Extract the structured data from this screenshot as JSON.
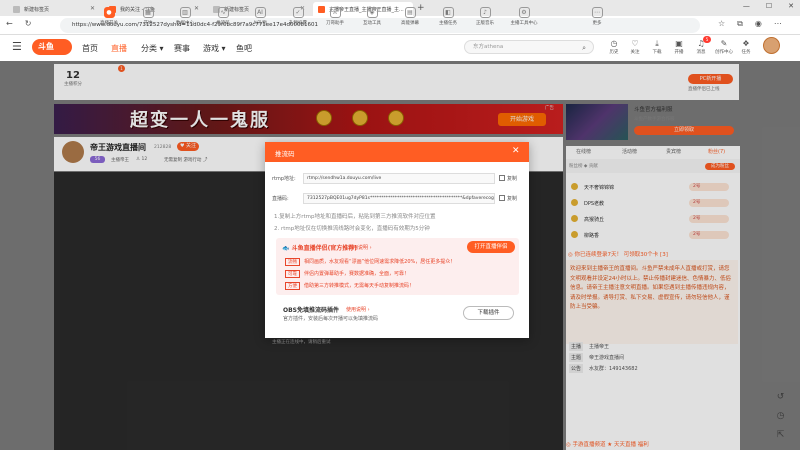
{
  "browser": {
    "tabs": [
      {
        "title": "新建标签页"
      },
      {
        "title": "我的关注 - 斗鱼"
      },
      {
        "title": "新建标签页"
      },
      {
        "title": "主播帝王直播_主播帝王直播_主..."
      }
    ],
    "url": "https://www.douyu.com/7312527dyshid=11d0dc4-f29f0bc89f7a9c771ee17e4d00081601"
  },
  "header": {
    "logo": "斗鱼",
    "nav": [
      "首页",
      "直播",
      "分类",
      "赛事",
      "游戏",
      "鱼吧"
    ],
    "search_placeholder": "东方athena",
    "top_icons": [
      "历史",
      "关注",
      "下载",
      "开播",
      "消息",
      "创作中心",
      "任务"
    ],
    "message_badge": "5"
  },
  "toolbar": {
    "level_number": "12",
    "level_label": "主播积分",
    "open_badge": "1",
    "tools": [
      "直播开关",
      "开始",
      "数据中心",
      "推流码",
      "AI礼物",
      "礼物投票",
      "刀哥助手",
      "互动工具",
      "高能弹幕",
      "主播任务",
      "正版音乐",
      "主播工具中心",
      "更多"
    ],
    "pc_button": "PC新开播",
    "pc_link": "直播伴侣已上线"
  },
  "banner": {
    "title": "超变一人一鬼服",
    "button": "开始游戏",
    "ad": "广告"
  },
  "game_ad": {
    "title": "斗鱼官方福利服",
    "subtitle": "斗鱼产数手游合作服",
    "button": "立即领取"
  },
  "streamer": {
    "name": "帝王游戏直播间",
    "room_id": "212828",
    "follow": "关注",
    "level": "56",
    "role": "主播帝王",
    "sub_count": "12",
    "category": "无需复制",
    "sub_category": "游戏行动"
  },
  "video": {
    "status_text": "主播正在连线中，请稍后重试"
  },
  "right_panel": {
    "tabs": [
      "在线榜",
      "活动榜",
      "贵宾榜",
      "粉丝(7)"
    ],
    "rank_label": "粉丝榜 ◆ 贡献",
    "rank_button": "成为粉丝",
    "rows": [
      {
        "name": "天不奢锦锦锦",
        "badge": "2号"
      },
      {
        "name": "DPS老教",
        "badge": "2号"
      },
      {
        "name": "高猴骑丘",
        "badge": "2号"
      },
      {
        "name": "柳路香",
        "badge": "2号"
      }
    ],
    "login_note": "◎ 你已连续登录7天！ 可领取30个卡 [3]",
    "notice": "欢迎来到主播帝王的直播间。斗鱼严禁未成年人直播或打赏，请您文明观看并设定24小时以上。禁止传播封建迷信、色情暴力、低俗信息。请帝王主播注意文明直播。如果您遇到主播传播违规内容，请及时举报。诱导打赏、私下交易、虚假宣传，请勿轻信他人，谨防上当受骗。",
    "info": [
      {
        "label": "主播",
        "value": "主播帝王"
      },
      {
        "label": "主题",
        "value": "帝王游戏直播间"
      },
      {
        "label": "公告",
        "value": "水友群：149143682"
      }
    ],
    "bottom_text": "◎ 手游直播频道 ★ 天天直播 福利"
  },
  "modal": {
    "title": "推流码",
    "rtmp_label": "rtmp地址:",
    "rtmp_value": "rtmp://sendhw1a.douyu.com/live",
    "code_label": "直播码:",
    "code_value": "7312527pBQE01ug7dyP81s*****************************************&dpfaverecognition=",
    "copy": "复制",
    "tip1": "1.复制上方rtmp地址和直播码后，粘贴到第三方推流软件对应位置",
    "tip2": "2. rtmp地址仅在切换推流线路时会变化，直播码有效期为5分钟",
    "promo_title": "斗鱼直播伴侣(官方推荐)",
    "promo_guide": "使用说明 ›",
    "promo_button": "打开直播伴侣",
    "promo_rows": [
      {
        "tag": "流畅",
        "text": "相同画质，水友观看“漂画”他位网速需求降低20%，居任更多提众！"
      },
      {
        "tag": "可靠",
        "text": "伴侣内置弹幕助手，赛数据准确，全面，可靠！"
      },
      {
        "tag": "方便",
        "text": "借助第三方转推模式，无需每天手动复制推流码！"
      }
    ],
    "obs_title": "OBS免填推流码插件",
    "obs_guide": "使用说明 ›",
    "obs_desc": "官方插件，安装后每次开播可以免填推流码",
    "obs_button": "下载插件"
  },
  "colors": {
    "brand": "#ff5d23"
  }
}
